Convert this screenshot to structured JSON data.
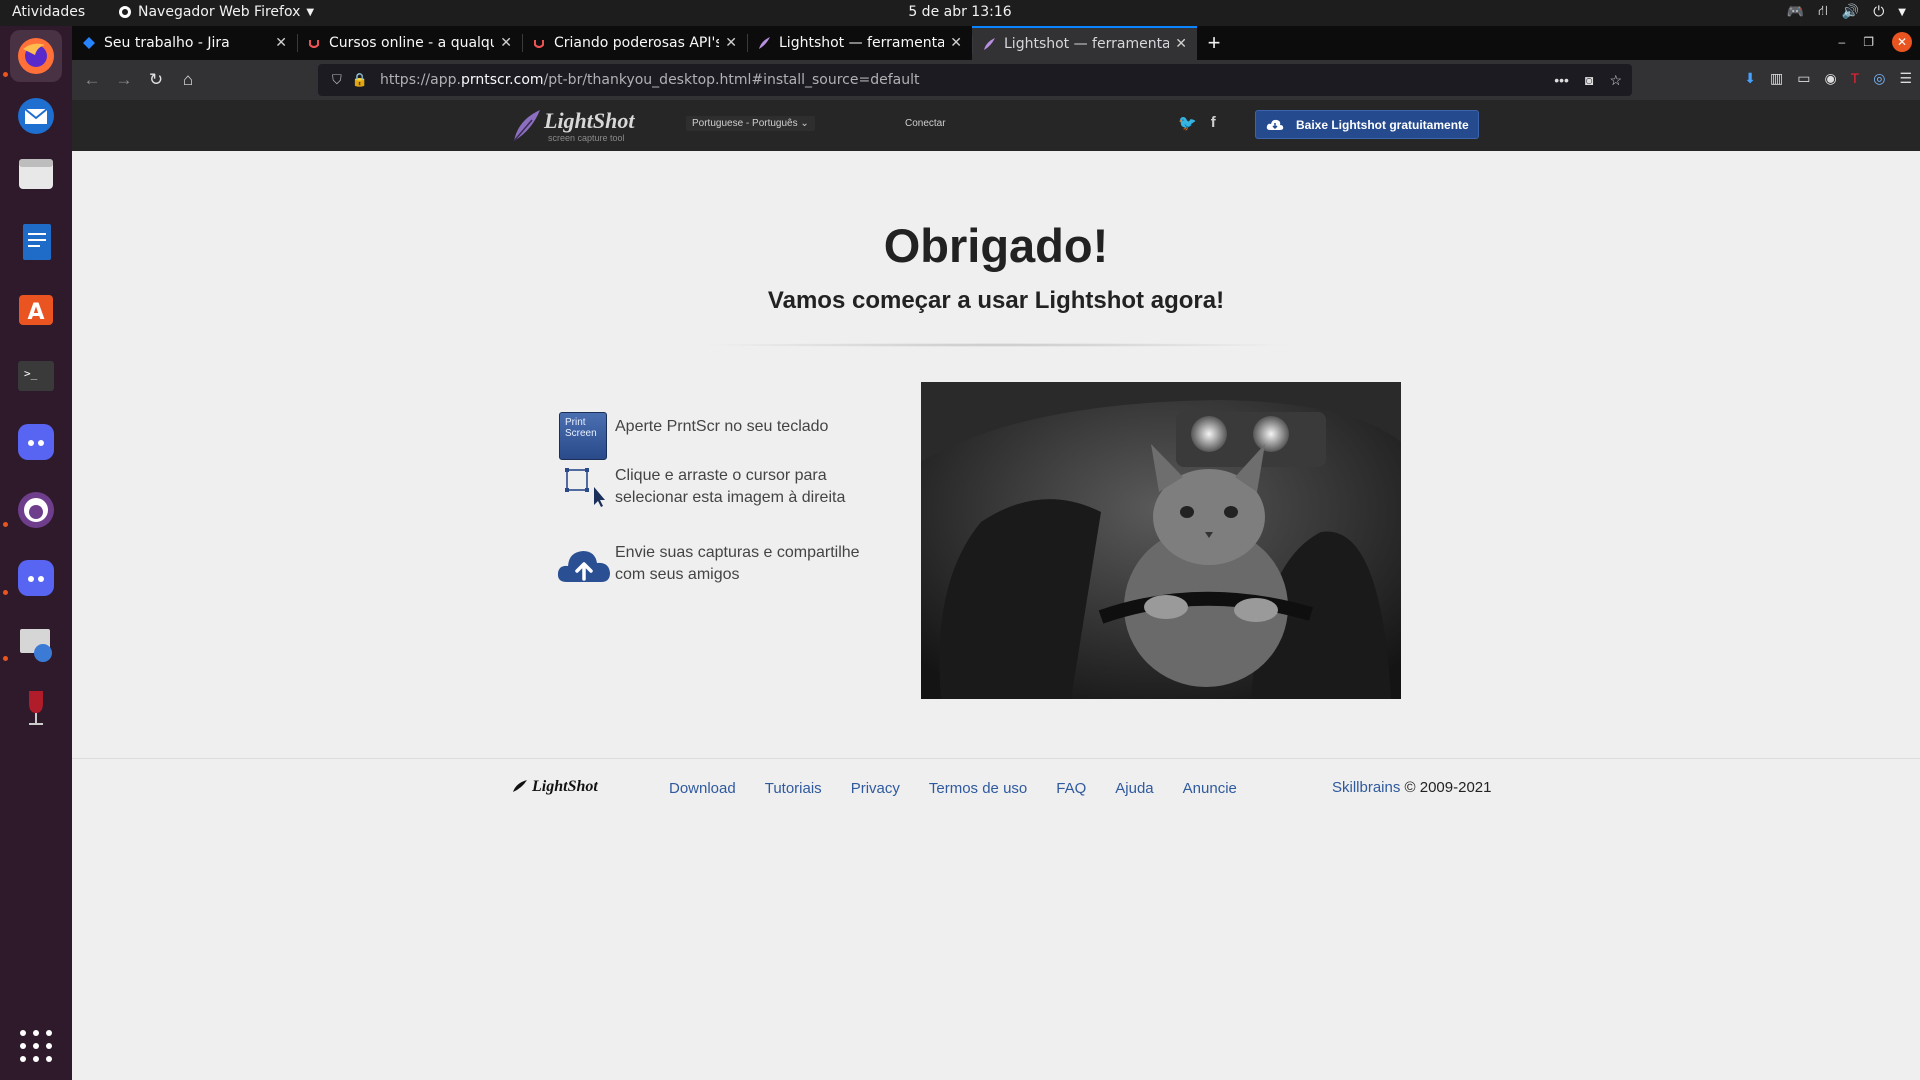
{
  "topbar": {
    "activities": "Atividades",
    "app_name": "Navegador Web Firefox",
    "clock": "5 de abr  13:16"
  },
  "dock": {
    "apps": [
      "firefox",
      "thunderbird",
      "files",
      "libreoffice-writer",
      "ubuntu-software",
      "terminal",
      "discord",
      "github-desktop",
      "discord",
      "update-manager",
      "wine"
    ]
  },
  "browser": {
    "tabs": [
      {
        "label": "Seu trabalho - Jira",
        "active": false
      },
      {
        "label": "Cursos online - a qualquer",
        "active": false
      },
      {
        "label": "Criando poderosas API's",
        "active": false
      },
      {
        "label": "Lightshot — ferramenta",
        "active": false
      },
      {
        "label": "Lightshot — ferramenta",
        "active": true
      }
    ],
    "url_prefix": "https://app.",
    "url_domain": "prntscr.com",
    "url_path": "/pt-br/thankyou_desktop.html#install_source=default"
  },
  "site": {
    "header": {
      "logo_name": "LightShot",
      "logo_tagline": "screen capture tool",
      "language": "Portuguese - Português",
      "login": "Conectar",
      "download_button": "Baixe Lightshot gratuitamente"
    },
    "main": {
      "title": "Obrigado!",
      "subtitle": "Vamos começar a usar Lightshot agora!",
      "print_key_label": "Print Screen",
      "steps": [
        "Aperte PrntScr no seu teclado",
        "Clique e arraste o cursor para selecionar esta imagem à direita",
        "Envie suas capturas e compartilhe com seus amigos"
      ]
    },
    "footer": {
      "logo": "LightShot",
      "links": [
        "Download",
        "Tutoriais",
        "Privacy",
        "Termos de uso",
        "FAQ",
        "Ajuda",
        "Anuncie"
      ],
      "company": "Skillbrains",
      "copyright": "© 2009-2021"
    }
  },
  "colors": {
    "accent_blue": "#0a84ff",
    "ubuntu_orange": "#e95420",
    "link_blue": "#2f5a9e",
    "download_button": "#254b8e"
  }
}
